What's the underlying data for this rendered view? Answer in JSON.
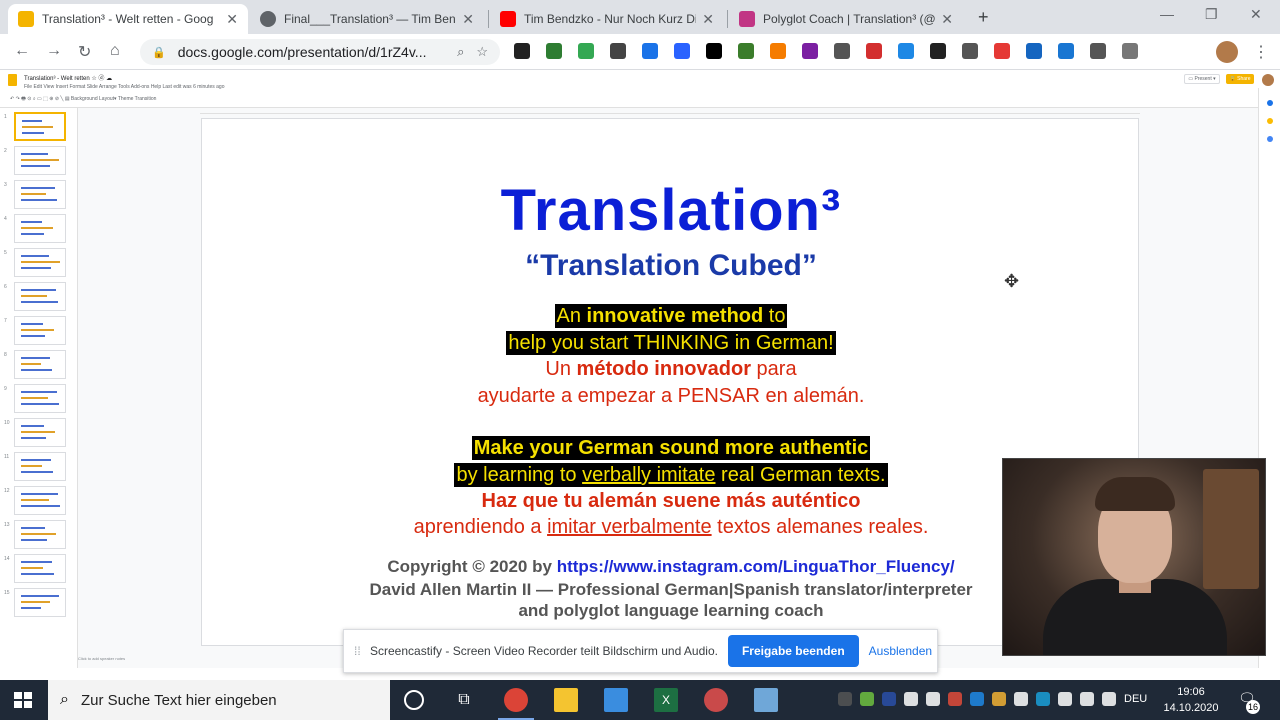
{
  "browser": {
    "tabs": [
      {
        "title": "Translation³ - Welt retten - Goog",
        "favicon_color": "#f4b400",
        "active": true
      },
      {
        "title": "Final___Translation³ — Tim Bend",
        "favicon_color": "#5f6368",
        "active": false
      },
      {
        "title": "Tim Bendzko - Nur Noch Kurz Di",
        "favicon_color": "#ff0000",
        "active": false
      },
      {
        "title": "Polyglot Coach | Translation³ (@l",
        "favicon_color": "#c13584",
        "active": false
      }
    ],
    "close_glyph": "✕",
    "new_tab_glyph": "+",
    "url": "docs.google.com/presentation/d/1rZ4v...",
    "extension_colors": [
      "#222",
      "#2e7d32",
      "#34a853",
      "#444",
      "#1a73e8",
      "#2962ff",
      "#000",
      "#3b7d2b",
      "#f57c00",
      "#7b1fa2",
      "#555",
      "#d32f2f",
      "#1e88e5",
      "#222",
      "#555",
      "#e53935",
      "#1565c0",
      "#1976d2",
      "#555",
      "#777"
    ]
  },
  "slides_app": {
    "doc_title": "Translation³ - Welt retten ☆ ⓓ ☁",
    "menu": "File  Edit  View  Insert  Format  Slide  Arrange  Tools  Add-ons  Help   Last edit was 6 minutes ago",
    "tools": "↶ ↷ 🖶 ⊙  ⌕ ▭ ⬚ ⊕ ⊘ ╲  ▤  Background  Layout▾  Theme  Transition",
    "present_label": "▭ Present ▾",
    "share_label": "🔒 Share",
    "notes_placeholder": "Click to add speaker notes",
    "thumbnail_count": 15,
    "selected_thumbnail": 1
  },
  "slide": {
    "title": "Translation³",
    "subtitle": "“Translation Cubed”",
    "en1_pre": "An ",
    "en1_bold": "innovative method",
    "en1_post": " to",
    "en2": "help you start THINKING in German!",
    "es1_pre": "Un ",
    "es1_bold": "método innovador",
    "es1_post": " para",
    "es2": "ayudarte a empezar a PENSAR en alemán.",
    "en3": "Make your German sound more authentic",
    "en4_pre": "by learning to ",
    "en4_u": "verbally imitate",
    "en4_post": " real German texts.",
    "es3": "Haz que tu alemán suene más auténtico",
    "es4_pre": "aprendiendo a ",
    "es4_u": "imitar verbalmente",
    "es4_post": " textos alemanes reales.",
    "copyright_pre": "Copyright © 2020 by ",
    "copyright_link": "https://www.instagram.com/LinguaThor_Fluency/",
    "author1": "David Allen Martin II — Professional German|Spanish translator/interpreter",
    "author2": "and polyglot language learning coach"
  },
  "banner": {
    "text": "Screencastify - Screen Video Recorder teilt Bildschirm und Audio.",
    "stop_label": "Freigabe beenden",
    "hide_label": "Ausblenden"
  },
  "taskbar": {
    "search_placeholder": "Zur Suche Text hier eingeben",
    "language": "DEU",
    "time": "19:06",
    "date": "14.10.2020",
    "notification_count": "16",
    "colors": {
      "chrome": "#db4437",
      "explorer": "#f4c430",
      "excel": "#1d6f42",
      "tray_bg": "#1f2937"
    }
  }
}
